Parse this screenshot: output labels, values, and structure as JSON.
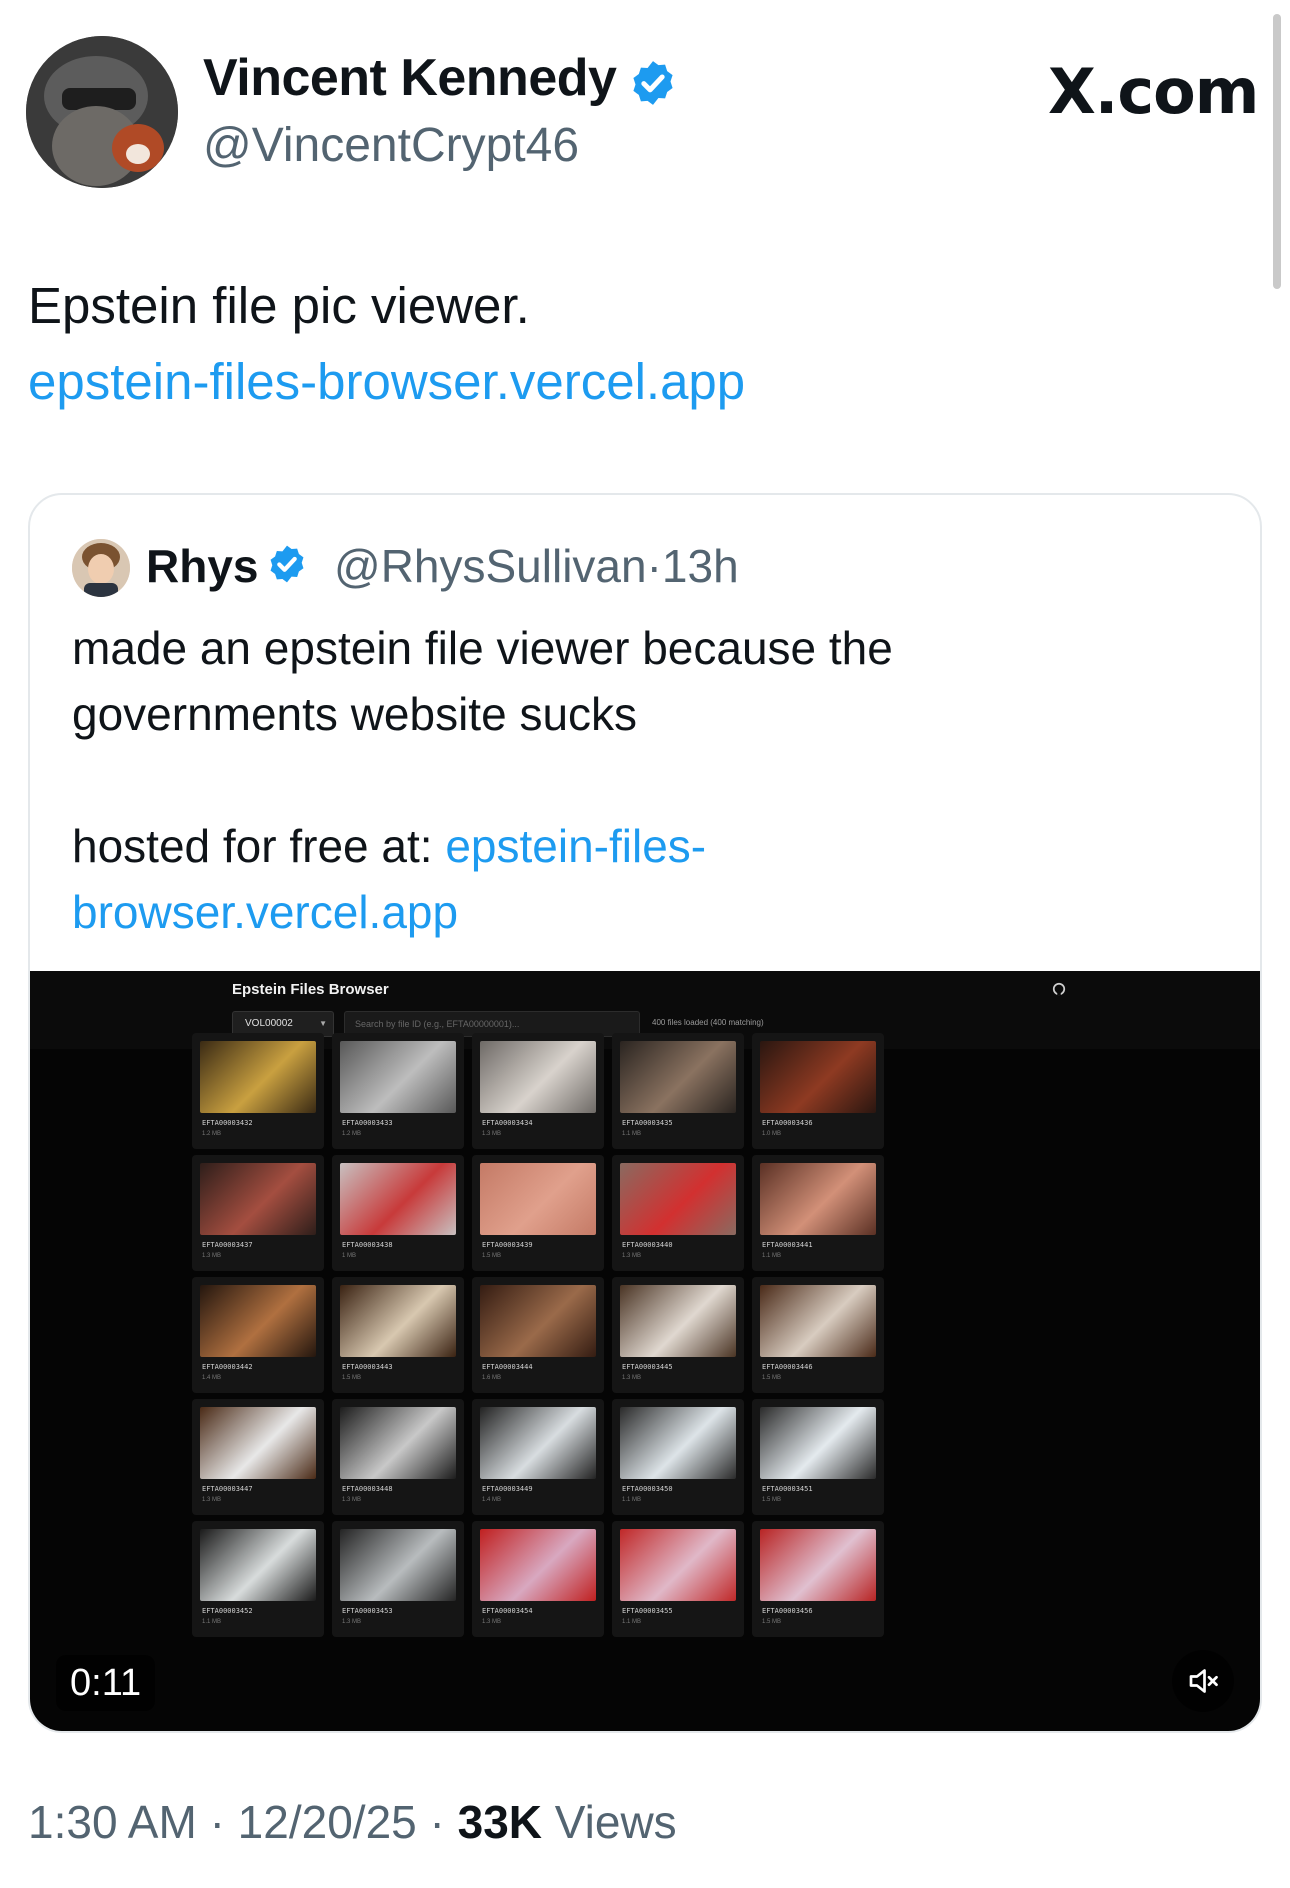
{
  "post": {
    "author_name": "Vincent Kennedy",
    "author_handle": "@VincentCrypt46",
    "site_label": "X.com",
    "text": "Epstein file pic viewer.",
    "link": "epstein-files-browser.vercel.app"
  },
  "quote": {
    "author_name": "Rhys",
    "author_handle": "@RhysSullivan",
    "separator": "·",
    "age": "13h",
    "text_line1": "made an epstein file viewer because the",
    "text_line2": "governments website sucks",
    "text_prefix": "hosted for free at: ",
    "link_part1": "epstein-files-",
    "link_part2": "browser.vercel.app"
  },
  "video": {
    "duration": "0:11",
    "app": {
      "title": "Epstein Files Browser",
      "volume": "VOL00002",
      "search_placeholder": "Search by file ID (e.g., EFTA00000001)...",
      "count_text": "400 files loaded (400 matching)",
      "tiles": [
        {
          "id": "EFTA00003432",
          "size": "1.2 MB",
          "c1": "#3a2a14",
          "c2": "#c9a040"
        },
        {
          "id": "EFTA00003433",
          "size": "1.2 MB",
          "c1": "#585858",
          "c2": "#bdbdbd"
        },
        {
          "id": "EFTA00003434",
          "size": "1.3 MB",
          "c1": "#6e6a66",
          "c2": "#d8d2cc"
        },
        {
          "id": "EFTA00003435",
          "size": "1.1 MB",
          "c1": "#2a2420",
          "c2": "#8a7260"
        },
        {
          "id": "EFTA00003436",
          "size": "1.0 MB",
          "c1": "#2a1610",
          "c2": "#8e3a22"
        },
        {
          "id": "EFTA00003437",
          "size": "1.3 MB",
          "c1": "#2e1e1a",
          "c2": "#a44e40"
        },
        {
          "id": "EFTA00003438",
          "size": "1 MB",
          "c1": "#c8c0c0",
          "c2": "#c83a3a"
        },
        {
          "id": "EFTA00003439",
          "size": "1.5 MB",
          "c1": "#c47a66",
          "c2": "#e0a08c"
        },
        {
          "id": "EFTA00003440",
          "size": "1.3 MB",
          "c1": "#8a6a60",
          "c2": "#d23030"
        },
        {
          "id": "EFTA00003441",
          "size": "1.1 MB",
          "c1": "#5a3024",
          "c2": "#d29078"
        },
        {
          "id": "EFTA00003442",
          "size": "1.4 MB",
          "c1": "#24160e",
          "c2": "#b07040"
        },
        {
          "id": "EFTA00003443",
          "size": "1.5 MB",
          "c1": "#3a2212",
          "c2": "#d8c8b0"
        },
        {
          "id": "EFTA00003444",
          "size": "1.6 MB",
          "c1": "#341c12",
          "c2": "#9a6a4a"
        },
        {
          "id": "EFTA00003445",
          "size": "1.3 MB",
          "c1": "#4a3424",
          "c2": "#e0d8d0"
        },
        {
          "id": "EFTA00003446",
          "size": "1.5 MB",
          "c1": "#4a2a18",
          "c2": "#d8ccc0"
        },
        {
          "id": "EFTA00003447",
          "size": "1.3 MB",
          "c1": "#4a2a16",
          "c2": "#e8e8e8"
        },
        {
          "id": "EFTA00003448",
          "size": "1.3 MB",
          "c1": "#1c1c1c",
          "c2": "#c8c8c8"
        },
        {
          "id": "EFTA00003449",
          "size": "1.4 MB",
          "c1": "#222222",
          "c2": "#d8dde0"
        },
        {
          "id": "EFTA00003450",
          "size": "1.1 MB",
          "c1": "#2a2a2a",
          "c2": "#dde4e8"
        },
        {
          "id": "EFTA00003451",
          "size": "1.5 MB",
          "c1": "#2a2a2a",
          "c2": "#e4eaee"
        },
        {
          "id": "EFTA00003452",
          "size": "1.1 MB",
          "c1": "#1a1a1a",
          "c2": "#d8dcdc"
        },
        {
          "id": "EFTA00003453",
          "size": "1.3 MB",
          "c1": "#242424",
          "c2": "#b8bcbe"
        },
        {
          "id": "EFTA00003454",
          "size": "1.3 MB",
          "c1": "#c02020",
          "c2": "#d8a8c0"
        },
        {
          "id": "EFTA00003455",
          "size": "1.1 MB",
          "c1": "#c02828",
          "c2": "#e0b8c8"
        },
        {
          "id": "EFTA00003456",
          "size": "1.5 MB",
          "c1": "#b82424",
          "c2": "#e0c0d0"
        }
      ]
    }
  },
  "meta": {
    "time": "1:30 AM",
    "date": "12/20/25",
    "separator": "·",
    "views_count": "33K",
    "views_label": "Views"
  },
  "colors": {
    "link_blue": "#1d9bf0",
    "muted_text": "#536471",
    "border": "#e4e8eb"
  },
  "icons": [
    "verified-badge-icon",
    "github-icon",
    "volume-muted-icon",
    "chevron-down-icon"
  ]
}
